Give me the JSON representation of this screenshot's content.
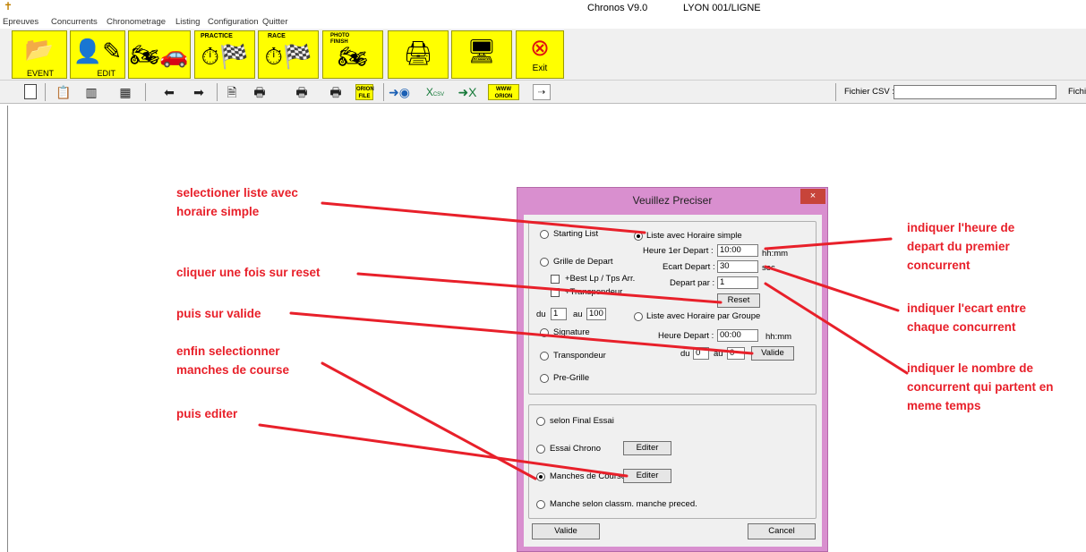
{
  "window": {
    "app_title": "Chronos V9.0",
    "site": "LYON  001/LIGNE"
  },
  "menu": [
    "Epreuves",
    "Concurrents",
    "Chronometrage",
    "Listing",
    "Configuration",
    "Quitter"
  ],
  "big_toolbar": {
    "event_label": "EVENT",
    "edit_label": "EDIT",
    "practice_label": "PRACTICE",
    "race_label": "RACE",
    "photo_finish_label": "PHOTO FINISH",
    "exit_label": "Exit"
  },
  "small_toolbar": {
    "orion_file": "ORION FILE",
    "xls_csv": "CSV",
    "www_orion": "WWW ORION",
    "csv_label": "Fichier CSV :",
    "csv_value": "",
    "csv_label2": "Fichie"
  },
  "dialog": {
    "title": "Veuillez Preciser",
    "close": "×",
    "starting_list": "Starting List",
    "grille_depart": "Grille de Depart",
    "best_lp": "+Best Lp / Tps Arr.",
    "transpondeur_chk": "+Transpondeur",
    "du_label": "du",
    "du_value": "1",
    "au_label": "au",
    "au_value": "100",
    "signature": "Signature",
    "transpondeur": "Transpondeur",
    "pre_grille": "Pre-Grille",
    "liste_horaire_simple": "Liste avec Horaire simple",
    "heure_1er_depart_label": "Heure 1er Depart :",
    "heure_1er_depart_value": "10:00",
    "hhmm": "hh:mm",
    "ecart_label": "Ecart Depart :",
    "ecart_value": "30",
    "sec": "sec",
    "depart_par_label": "Depart par :",
    "depart_par_value": "1",
    "reset": "Reset",
    "liste_horaire_groupe": "Liste avec Horaire par Groupe",
    "heure_depart_label": "Heure Depart :",
    "heure_depart_value": "00:00",
    "hhmm2": "hh:mm",
    "du2_label": "du",
    "du2_value": "0",
    "au2_label": "au",
    "au2_value": "0",
    "valide_small": "Valide",
    "selon_final_essai": "selon Final Essai",
    "essai_chrono": "Essai Chrono",
    "editer1": "Editer",
    "manches_course": "Manches de Course",
    "editer2": "Editer",
    "manche_classm": "Manche selon classm. manche preced.",
    "valide": "Valide",
    "cancel": "Cancel"
  },
  "annotations": {
    "a1_l1": "selectioner liste avec",
    "a1_l2": "horaire simple",
    "a2": "cliquer une fois sur reset",
    "a3": "puis sur valide",
    "a4_l1": "enfin selectionner",
    "a4_l2": "manches de course",
    "a5": "puis editer",
    "r1_l1": "indiquer l'heure de",
    "r1_l2": "depart du premier",
    "r1_l3": "concurrent",
    "r2_l1": "indiquer l'ecart entre",
    "r2_l2": "chaque concurrent",
    "r3_l1": "indiquer le nombre de",
    "r3_l2": "concurrent qui partent en",
    "r3_l3": "meme temps"
  },
  "colors": {
    "annotation": "#e8202a",
    "toolbar_yellow": "#ffff00",
    "dialog_border": "#d98fcf",
    "close_red": "#c7443a"
  }
}
